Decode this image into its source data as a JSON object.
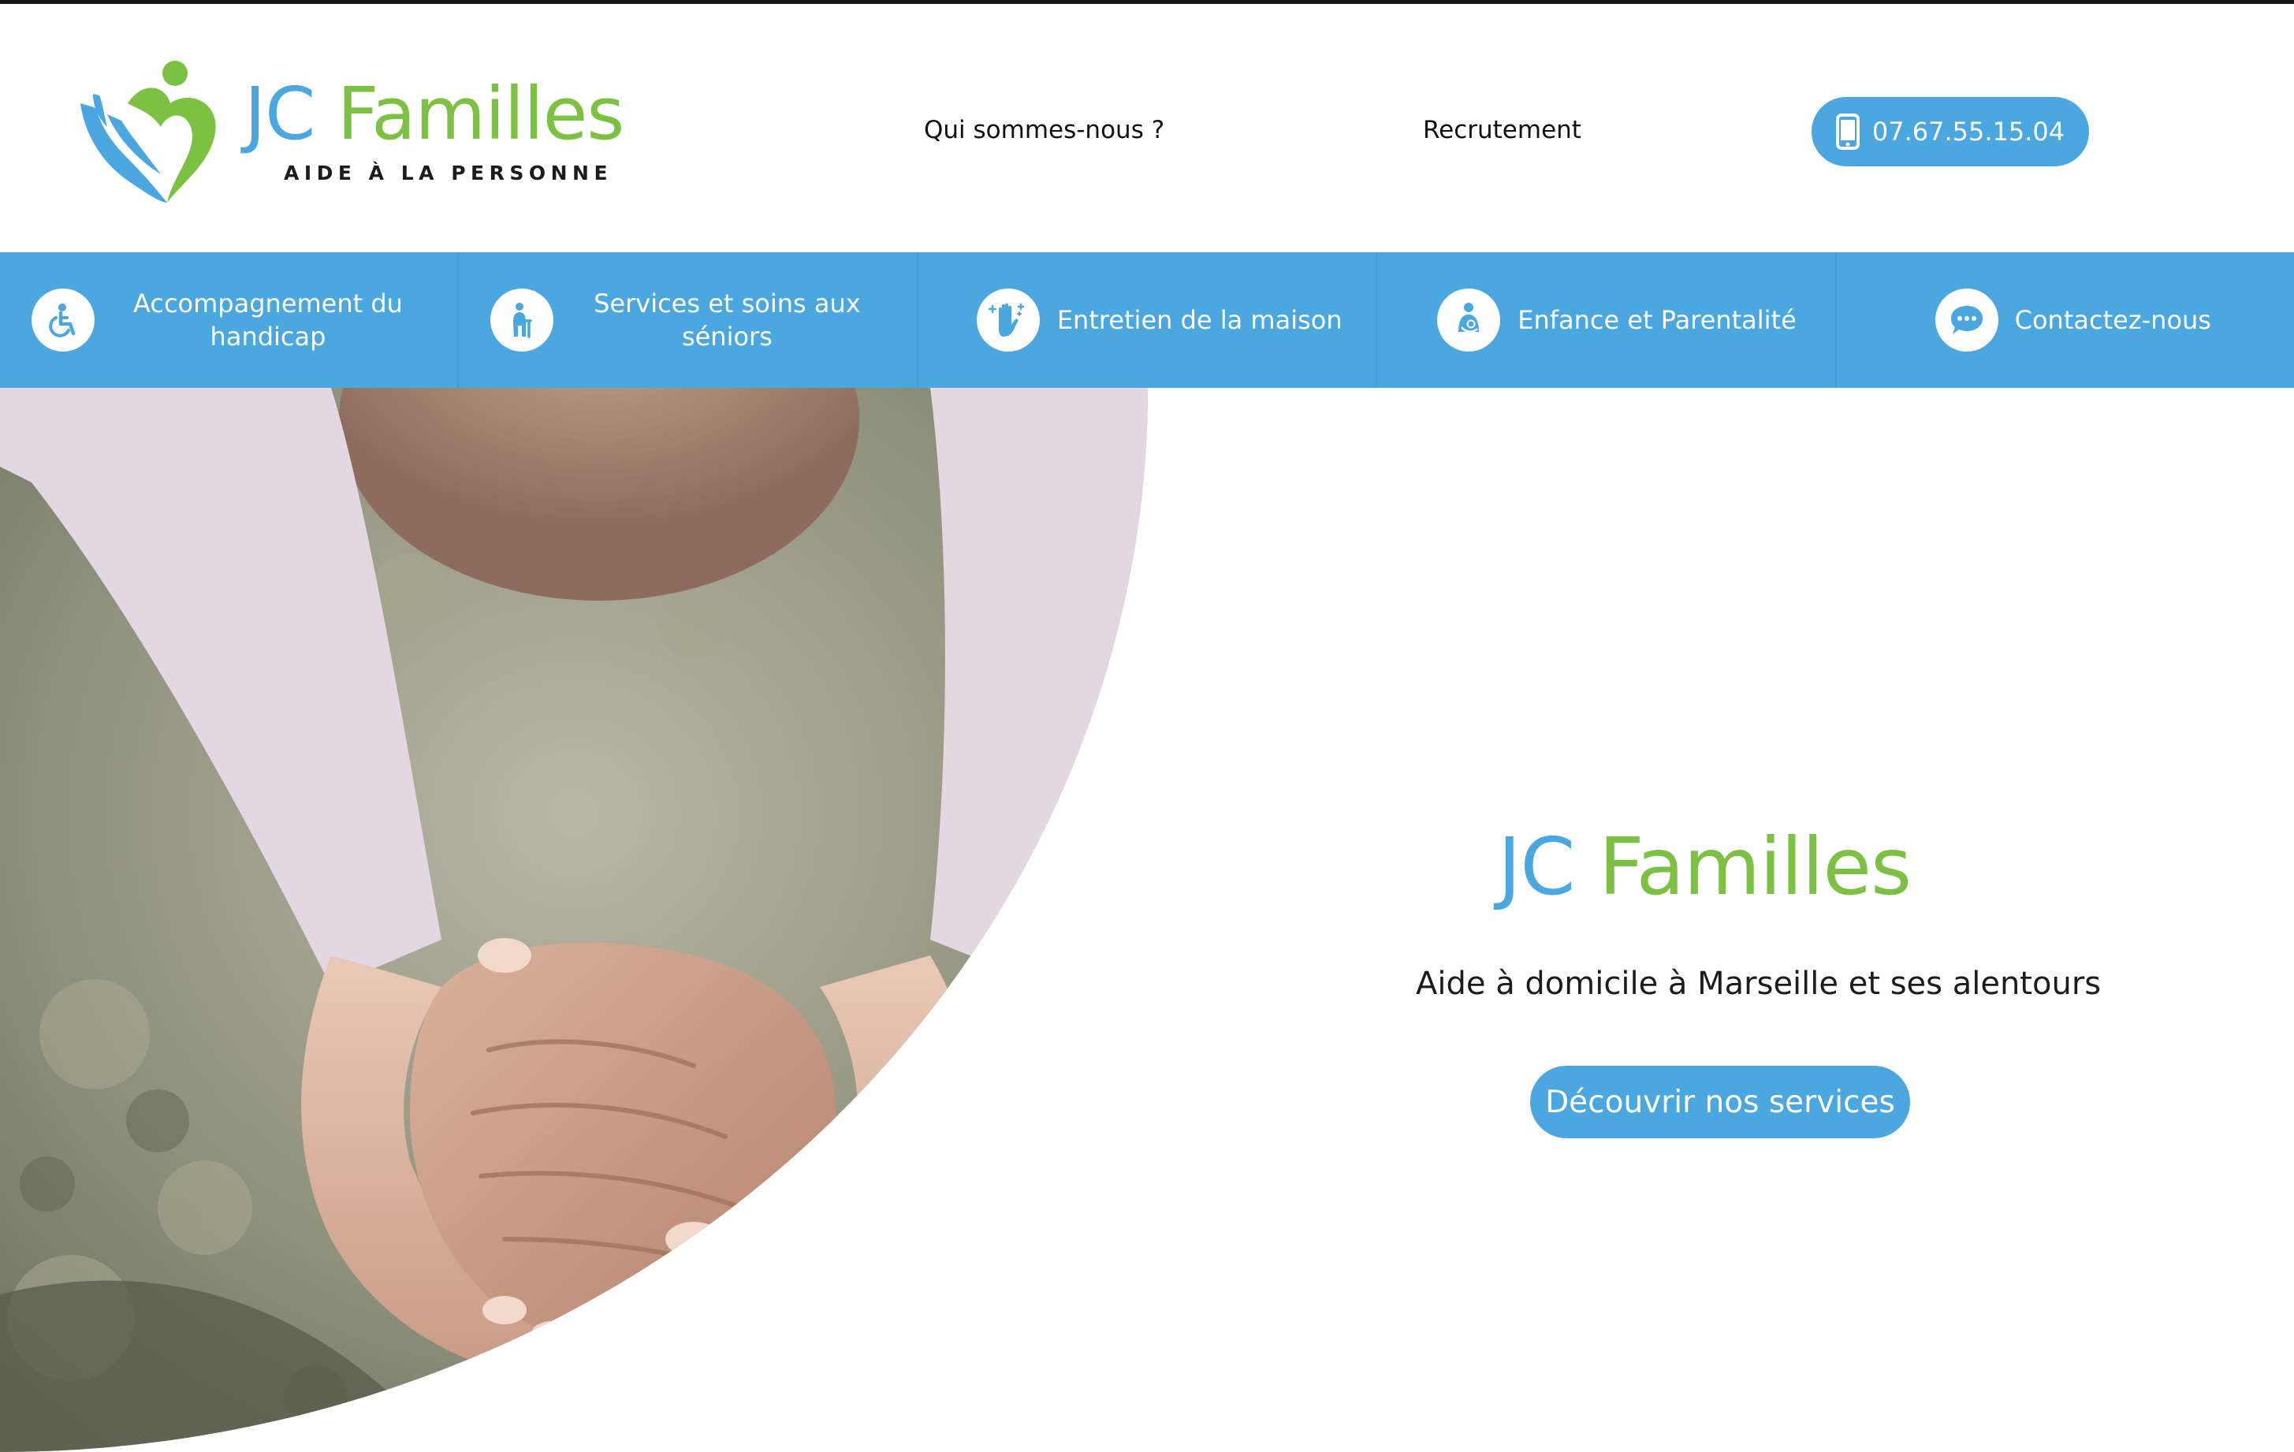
{
  "colors": {
    "primary_blue": "#4ba7e0",
    "brand_green": "#7cc142",
    "text_dark": "#1a1a1a"
  },
  "logo": {
    "name_part1": "JC",
    "name_part2": "Familles",
    "tagline": "AIDE À LA PERSONNE",
    "icon": "heart-hands-logo-icon"
  },
  "top_nav": {
    "about": "Qui sommes-nous ?",
    "jobs": "Recrutement"
  },
  "phone": {
    "number": "07.67.55.15.04",
    "icon": "smartphone-icon"
  },
  "services": [
    {
      "label": "Accompagnement du handicap",
      "icon": "wheelchair-icon"
    },
    {
      "label": "Services et soins aux séniors",
      "icon": "senior-person-icon"
    },
    {
      "label": "Entretien de la maison",
      "icon": "cleaning-hand-icon"
    },
    {
      "label": "Enfance et Parentalité",
      "icon": "parent-child-icon"
    },
    {
      "label": "Contactez-nous",
      "icon": "chat-bubble-icon"
    }
  ],
  "hero": {
    "title_part1": "JC",
    "title_part2": "Familles",
    "subtitle": "Aide à domicile à Marseille et ses alentours",
    "cta": "Découvrir nos services",
    "image": "hands-holding-elderly-hands-photo"
  }
}
